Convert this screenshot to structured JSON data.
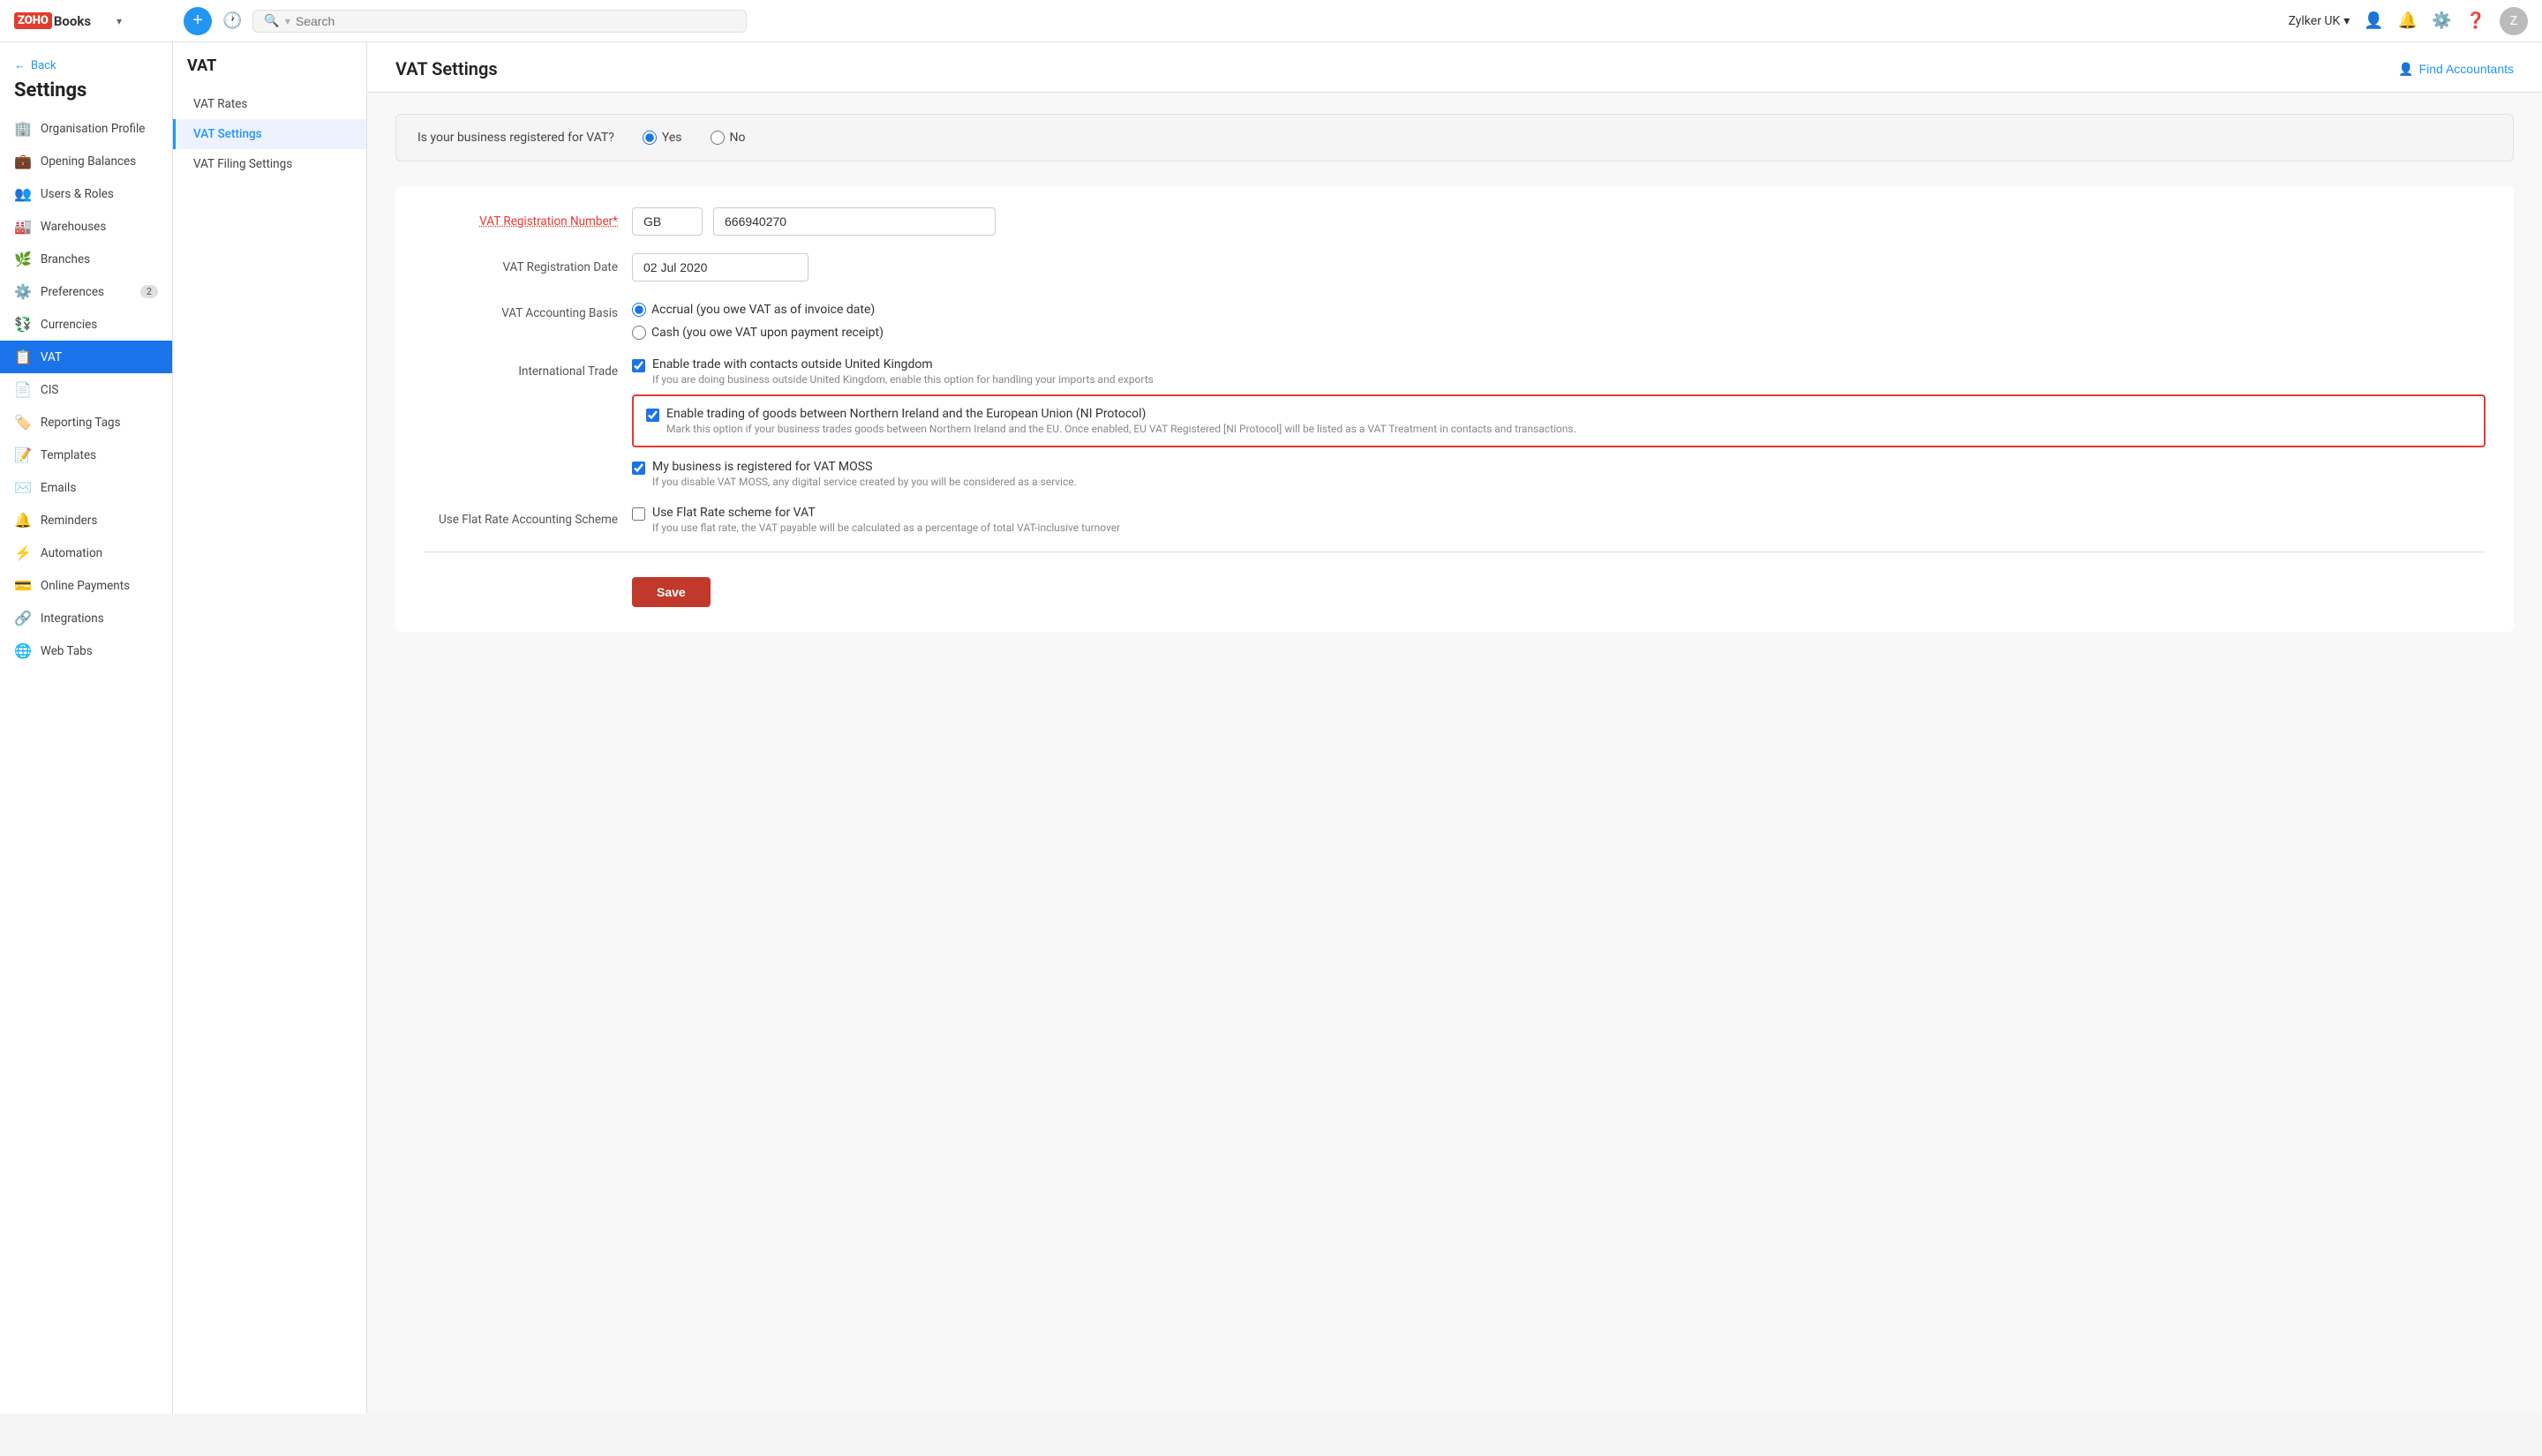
{
  "app": {
    "logo_text": "ZOHO Books",
    "org_name": "Zylker UK",
    "search_placeholder": "Search"
  },
  "sidebar": {
    "back_label": "Back",
    "title": "Settings",
    "items": [
      {
        "id": "organisation-profile",
        "label": "Organisation Profile",
        "icon": "🏢",
        "active": false
      },
      {
        "id": "opening-balances",
        "label": "Opening Balances",
        "icon": "💼",
        "active": false
      },
      {
        "id": "users-roles",
        "label": "Users & Roles",
        "icon": "👥",
        "active": false
      },
      {
        "id": "warehouses",
        "label": "Warehouses",
        "icon": "🏭",
        "active": false
      },
      {
        "id": "branches",
        "label": "Branches",
        "icon": "🌿",
        "active": false
      },
      {
        "id": "preferences",
        "label": "Preferences",
        "icon": "⚙️",
        "active": false,
        "badge": "2"
      },
      {
        "id": "currencies",
        "label": "Currencies",
        "icon": "💱",
        "active": false
      },
      {
        "id": "vat",
        "label": "VAT",
        "icon": "📋",
        "active": true
      },
      {
        "id": "cis",
        "label": "CIS",
        "icon": "📄",
        "active": false
      },
      {
        "id": "reporting-tags",
        "label": "Reporting Tags",
        "icon": "🏷️",
        "active": false
      },
      {
        "id": "templates",
        "label": "Templates",
        "icon": "📝",
        "active": false
      },
      {
        "id": "emails",
        "label": "Emails",
        "icon": "✉️",
        "active": false
      },
      {
        "id": "reminders",
        "label": "Reminders",
        "icon": "🔔",
        "active": false
      },
      {
        "id": "automation",
        "label": "Automation",
        "icon": "⚡",
        "active": false
      },
      {
        "id": "online-payments",
        "label": "Online Payments",
        "icon": "💳",
        "active": false
      },
      {
        "id": "integrations",
        "label": "Integrations",
        "icon": "🔗",
        "active": false
      },
      {
        "id": "web-tabs",
        "label": "Web Tabs",
        "icon": "🌐",
        "active": false
      }
    ]
  },
  "sub_panel": {
    "title": "VAT",
    "items": [
      {
        "id": "vat-rates",
        "label": "VAT Rates",
        "active": false
      },
      {
        "id": "vat-settings",
        "label": "VAT Settings",
        "active": true
      },
      {
        "id": "vat-filing-settings",
        "label": "VAT Filing Settings",
        "active": false
      }
    ]
  },
  "main": {
    "title": "VAT Settings",
    "find_accountants_label": "Find Accountants",
    "vat_registered_question": "Is your business registered for VAT?",
    "vat_registered_yes": "Yes",
    "vat_registered_no": "No",
    "vat_reg_number_label": "VAT Registration Number*",
    "vat_reg_prefix": "GB",
    "vat_reg_number": "666940270",
    "vat_reg_date_label": "VAT Registration Date",
    "vat_reg_date_value": "02 Jul 2020",
    "vat_accounting_basis_label": "VAT Accounting Basis",
    "accrual_label": "Accrual (you owe VAT as of invoice date)",
    "cash_label": "Cash (you owe VAT upon payment receipt)",
    "international_trade_label": "International Trade",
    "enable_trade_label": "Enable trade with contacts outside United Kingdom",
    "enable_trade_sub": "If you are doing business outside United Kingdom, enable this option for handling your imports and exports",
    "ni_protocol_label": "Enable trading of goods between Northern Ireland and the European Union (NI Protocol)",
    "ni_protocol_sub": "Mark this option if your business trades goods between Northern Ireland and the EU. Once enabled, EU VAT Registered [NI Protocol] will be listed as a VAT Treatment in contacts and transactions.",
    "vat_moss_label": "My business is registered for VAT MOSS",
    "vat_moss_sub": "If you disable VAT MOSS, any digital service created by you will be considered as a service.",
    "flat_rate_label": "Use Flat Rate Accounting Scheme",
    "flat_rate_checkbox_label": "Use Flat Rate scheme for VAT",
    "flat_rate_sub": "If you use flat rate, the VAT payable will be calculated as a percentage of total VAT-inclusive turnover",
    "save_label": "Save"
  }
}
